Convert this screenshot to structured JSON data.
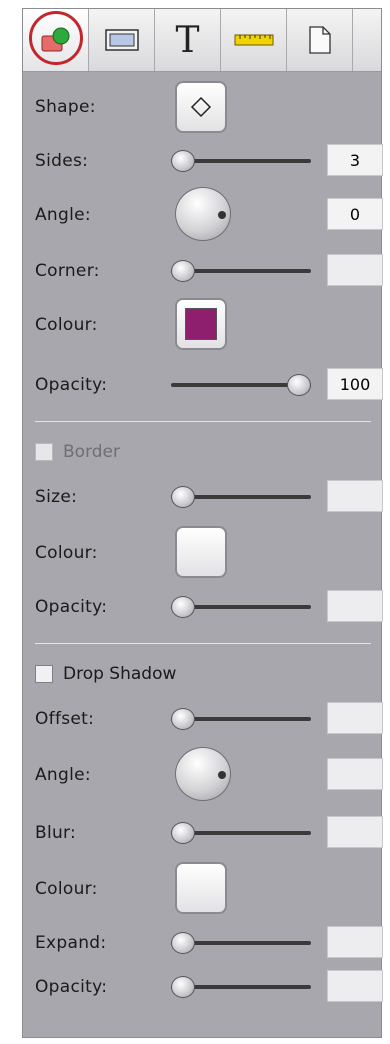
{
  "toolbar": {
    "tabs": [
      {
        "name": "shape-tab",
        "icon": "shape-icon",
        "active": true
      },
      {
        "name": "rectangle-tab",
        "icon": "rectangle-icon"
      },
      {
        "name": "text-tab",
        "icon": "text-icon",
        "glyph": "T"
      },
      {
        "name": "ruler-tab",
        "icon": "ruler-icon"
      },
      {
        "name": "page-tab",
        "icon": "page-icon"
      }
    ]
  },
  "shape": {
    "shape_label": "Shape:",
    "shape_icon": "diamond-icon",
    "sides_label": "Sides:",
    "sides_value": "3",
    "angle_label": "Angle:",
    "angle_value": "0",
    "corner_label": "Corner:",
    "colour_label": "Colour:",
    "colour_value": "#8e1f6e",
    "opacity_label": "Opacity:",
    "opacity_value": "100"
  },
  "border": {
    "toggle_label": "Border",
    "size_label": "Size:",
    "colour_label": "Colour:",
    "opacity_label": "Opacity:"
  },
  "shadow": {
    "toggle_label": "Drop Shadow",
    "offset_label": "Offset:",
    "angle_label": "Angle:",
    "blur_label": "Blur:",
    "colour_label": "Colour:",
    "expand_label": "Expand:",
    "opacity_label": "Opacity:"
  }
}
